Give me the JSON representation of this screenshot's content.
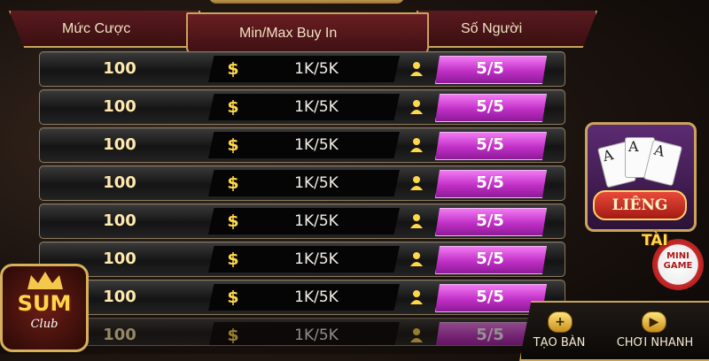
{
  "header": {
    "bet_title": "Mức Cược",
    "buyin_title": "Min/Max Buy In",
    "players_title": "Số Người"
  },
  "rows": [
    {
      "bet": "100",
      "currency_symbol": "$",
      "buyin": "1K/5K",
      "players": "5/5"
    },
    {
      "bet": "100",
      "currency_symbol": "$",
      "buyin": "1K/5K",
      "players": "5/5"
    },
    {
      "bet": "100",
      "currency_symbol": "$",
      "buyin": "1K/5K",
      "players": "5/5"
    },
    {
      "bet": "100",
      "currency_symbol": "$",
      "buyin": "1K/5K",
      "players": "5/5"
    },
    {
      "bet": "100",
      "currency_symbol": "$",
      "buyin": "1K/5K",
      "players": "5/5"
    },
    {
      "bet": "100",
      "currency_symbol": "$",
      "buyin": "1K/5K",
      "players": "5/5"
    },
    {
      "bet": "100",
      "currency_symbol": "$",
      "buyin": "1K/5K",
      "players": "5/5"
    },
    {
      "bet": "100",
      "currency_symbol": "$",
      "buyin": "1K/5K",
      "players": "5/5"
    }
  ],
  "side_games": {
    "lieng_label": "LIÊNG",
    "card_rank": "A",
    "tai_label": "TÀI",
    "mini_game_label": "MINI GAME"
  },
  "logo": {
    "main": "SUM",
    "sub": "Club"
  },
  "actions": {
    "create_table_label": "TẠO BÀN",
    "create_table_icon": "plus-icon",
    "quick_play_label": "CHƠI NHANH",
    "quick_play_icon": "play-icon"
  },
  "colors": {
    "accent_gold": "#c9a45a",
    "players_magenta": "#c02fc6",
    "header_red": "#5a1a1e"
  }
}
